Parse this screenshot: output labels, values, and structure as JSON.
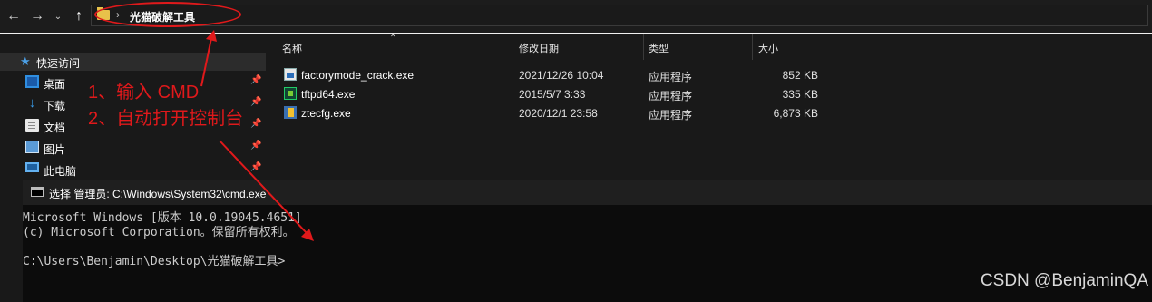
{
  "toolbar": {
    "back_icon": "arrow-left-icon",
    "forward_icon": "arrow-right-icon",
    "recent_icon": "chevron-down-icon",
    "up_icon": "arrow-up-icon"
  },
  "address_bar": {
    "path": "光猫破解工具"
  },
  "sidebar": {
    "quick_access": "快速访问",
    "items": [
      {
        "label": "桌面",
        "icon": "desktop-icon"
      },
      {
        "label": "下载",
        "icon": "download-icon"
      },
      {
        "label": "文档",
        "icon": "document-icon"
      },
      {
        "label": "图片",
        "icon": "pictures-icon"
      },
      {
        "label": "此电脑",
        "icon": "this-pc-icon"
      }
    ]
  },
  "file_list": {
    "headers": {
      "name": "名称",
      "date": "修改日期",
      "type": "类型",
      "size": "大小"
    },
    "files": [
      {
        "name": "factorymode_crack.exe",
        "date": "2021/12/26 10:04",
        "type": "应用程序",
        "size": "852 KB"
      },
      {
        "name": "tftpd64.exe",
        "date": "2015/5/7 3:33",
        "type": "应用程序",
        "size": "335 KB"
      },
      {
        "name": "ztecfg.exe",
        "date": "2020/12/1 23:58",
        "type": "应用程序",
        "size": "6,873 KB"
      }
    ]
  },
  "annotations": {
    "step1": "1、输入 CMD",
    "step2": "2、自动打开控制台",
    "color": "#e0191b"
  },
  "cmd": {
    "title": "选择 管理员: C:\\Windows\\System32\\cmd.exe",
    "line1": "Microsoft Windows [版本 10.0.19045.4651]",
    "line2": "(c) Microsoft Corporation。保留所有权利。",
    "prompt": "C:\\Users\\Benjamin\\Desktop\\光猫破解工具>"
  },
  "watermark": "CSDN @BenjaminQA"
}
